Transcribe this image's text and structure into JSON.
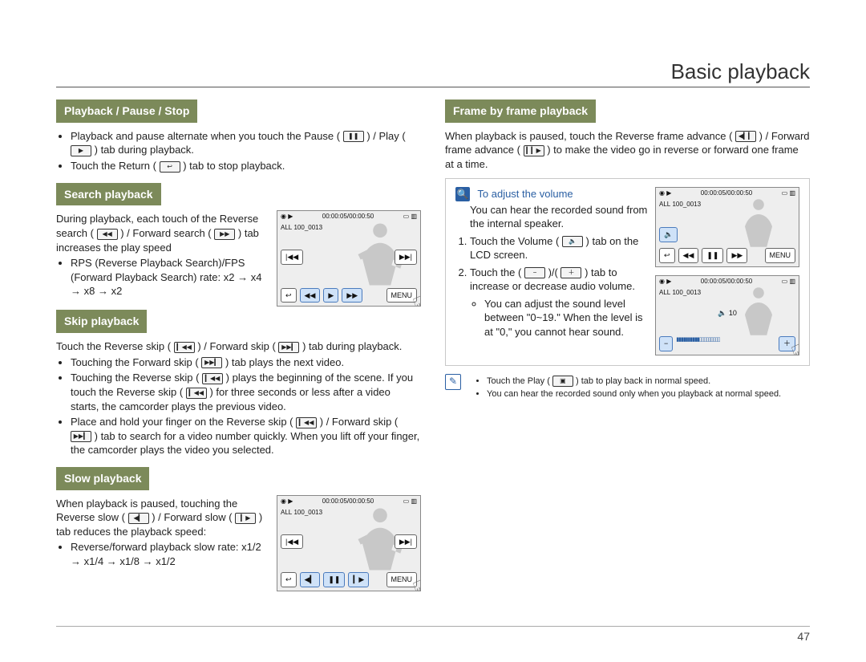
{
  "page": {
    "title": "Basic playback",
    "number": "47"
  },
  "icons": {
    "pause": "❚❚",
    "play": "▶",
    "return": "↩",
    "rsearch": "◀◀",
    "fsearch": "▶▶",
    "rskip": "▎◀◀",
    "fskip": "▶▶▎",
    "rslow": "◀▎",
    "fslow": "▎▶",
    "rframe": "◀▎▎",
    "fframe": "▎▎▶",
    "volume": "🔈",
    "minus": "−",
    "plus": "＋",
    "playbox": "▣",
    "menu": "MENU"
  },
  "left": {
    "s1": {
      "heading": "Playback / Pause / Stop",
      "b1a": "Playback and pause alternate when you touch the Pause (",
      "b1b": ") / Play (",
      "b1c": ") tab during playback.",
      "b2a": "Touch the Return (",
      "b2b": ") tab to stop playback."
    },
    "s2": {
      "heading": "Search playback",
      "p1a": "During playback, each touch of the Reverse search (",
      "p1b": ") / Forward search (",
      "p1c": ") tab increases the play speed",
      "b1": "RPS (Reverse Playback Search)/FPS (Forward Playback Search) rate: x2 → x4 → x8 → x2"
    },
    "s3": {
      "heading": "Skip playback",
      "p1a": "Touch the Reverse skip (",
      "p1b": ") / Forward skip (",
      "p1c": ") tab during playback.",
      "b1a": "Touching the Forward skip (",
      "b1b": ") tab plays the next video.",
      "b2a": "Touching the Reverse skip (",
      "b2b": ") plays the beginning of the scene. If you touch the Reverse skip (",
      "b2c": ") for three seconds or less after a video starts, the camcorder plays the previous video.",
      "b3a": "Place and hold your finger on the Reverse skip (",
      "b3b": ") / Forward skip (",
      "b3c": ") tab to search for a video number quickly. When you lift off your finger, the camcorder plays the video you selected."
    },
    "s4": {
      "heading": "Slow playback",
      "p1a": "When playback is paused, touching the Reverse slow (",
      "p1b": ") / Forward slow (",
      "p1c": ") tab reduces the playback speed:",
      "b1": "Reverse/forward playback slow rate: x1/2 → x1/4 → x1/8 → x1/2"
    }
  },
  "right": {
    "s5": {
      "heading": "Frame by frame playback",
      "p1a": "When playback is paused, touch the Reverse frame advance (",
      "p1b": ") / Forward frame advance (",
      "p1c": ") to make the video go in reverse or forward one frame at a time."
    },
    "note": {
      "title": "To adjust the volume",
      "p1": "You can hear the recorded sound from the internal speaker.",
      "li1a": "Touch the Volume (",
      "li1b": ") tab on the LCD screen.",
      "li2a": "Touch the (",
      "li2b": ")/(",
      "li2c": ") tab to increase or decrease audio volume.",
      "sub1": "You can adjust the sound level between \"0~19.\" When the level is at \"0,\" you cannot hear sound.",
      "volval": "10"
    },
    "foot": {
      "b1a": "Touch the Play (",
      "b1b": ") tab to play back in normal speed.",
      "b2": "You can hear the recorded sound only when you playback at normal speed."
    }
  },
  "thumb": {
    "time": "00:00:05/00:00:50",
    "file": "100_0013",
    "all": "ALL",
    "menu": "MENU"
  }
}
